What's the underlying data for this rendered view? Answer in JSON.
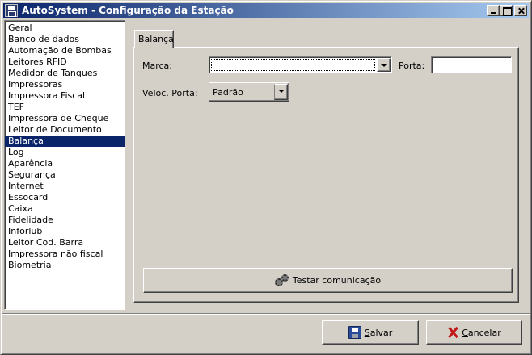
{
  "window": {
    "title": "AutoSystem - Configuração da Estação"
  },
  "sidebar": {
    "items": [
      {
        "label": "Geral"
      },
      {
        "label": "Banco de dados"
      },
      {
        "label": "Automação de Bombas"
      },
      {
        "label": "Leitores RFID"
      },
      {
        "label": "Medidor de Tanques"
      },
      {
        "label": "Impressoras"
      },
      {
        "label": "Impressora Fiscal"
      },
      {
        "label": "TEF"
      },
      {
        "label": "Impressora de Cheque"
      },
      {
        "label": "Leitor de Documento"
      },
      {
        "label": "Balança",
        "selected": true
      },
      {
        "label": "Log"
      },
      {
        "label": "Aparência"
      },
      {
        "label": "Segurança"
      },
      {
        "label": "Internet"
      },
      {
        "label": "Essocard"
      },
      {
        "label": "Caixa"
      },
      {
        "label": "Fidelidade"
      },
      {
        "label": "Inforlub"
      },
      {
        "label": "Leitor Cod. Barra"
      },
      {
        "label": "Impressora não fiscal"
      },
      {
        "label": "Biometria"
      }
    ]
  },
  "main": {
    "tab_label": "Balança",
    "marca_label": "Marca:",
    "marca_value": "",
    "porta_label": "Porta:",
    "porta_value": "",
    "veloc_label": "Veloc. Porta:",
    "veloc_value": "Padrão",
    "test_button_label": "Testar comunicação"
  },
  "footer": {
    "save_first": "S",
    "save_rest": "alvar",
    "cancel_first": "C",
    "cancel_rest": "ancelar"
  },
  "icons": {
    "app": "app-icon",
    "minimize": "minimize-icon",
    "maximize": "maximize-icon",
    "close": "close-icon",
    "test": "gears-icon",
    "save": "floppy-disk-icon",
    "cancel": "red-x-icon"
  }
}
